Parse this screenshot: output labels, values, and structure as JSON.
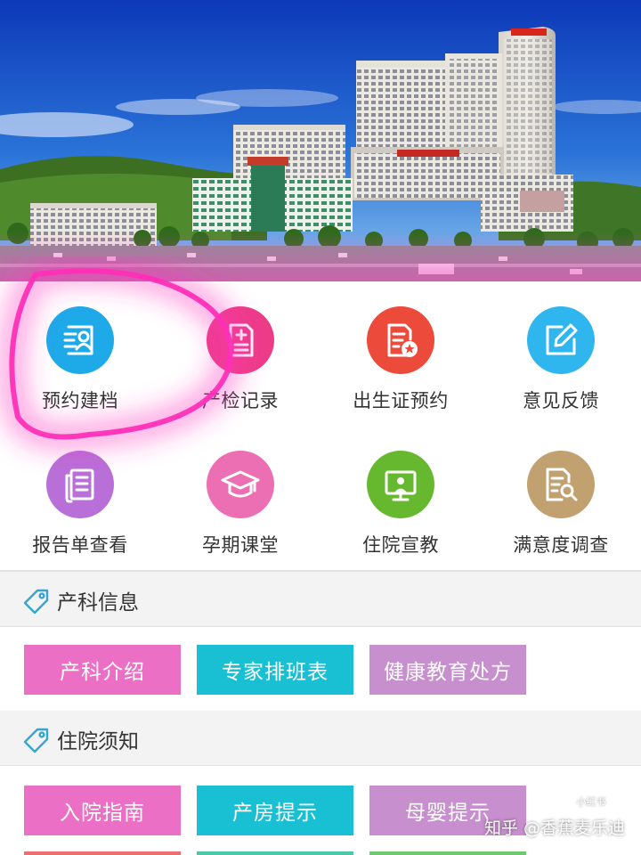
{
  "banner": {
    "image": "hospital-building-photo"
  },
  "grid": {
    "items": [
      {
        "label": "预约建档",
        "icon": "user-card-icon",
        "color": "#1ea9e8"
      },
      {
        "label": "产检记录",
        "icon": "medical-record-icon",
        "color": "#ec3c88"
      },
      {
        "label": "出生证预约",
        "icon": "certificate-star-icon",
        "color": "#ec4a3b"
      },
      {
        "label": "意见反馈",
        "icon": "edit-note-icon",
        "color": "#2fb6ee"
      },
      {
        "label": "报告单查看",
        "icon": "report-list-icon",
        "color": "#b86fd8"
      },
      {
        "label": "孕期课堂",
        "icon": "graduation-cap-icon",
        "color": "#ec6fb4"
      },
      {
        "label": "住院宣教",
        "icon": "presenter-board-icon",
        "color": "#66b92e"
      },
      {
        "label": "满意度调查",
        "icon": "document-search-icon",
        "color": "#c2a171"
      }
    ]
  },
  "sections": [
    {
      "title": "产科信息",
      "icon": "tag-icon",
      "buttons": [
        {
          "label": "产科介绍",
          "color": "#ec6fc6"
        },
        {
          "label": "专家排班表",
          "color": "#19bfd3"
        },
        {
          "label": "健康教育处方",
          "color": "#c78fce"
        }
      ]
    },
    {
      "title": "住院须知",
      "icon": "tag-icon",
      "buttons": [
        {
          "label": "入院指南",
          "color": "#ec6fc6"
        },
        {
          "label": "产房提示",
          "color": "#19bfd3"
        },
        {
          "label": "母婴提示",
          "color": "#c78fce"
        }
      ]
    }
  ],
  "watermark": {
    "text": "知乎 @香蕉麦乐迪",
    "badge": "小红书"
  },
  "colors": {
    "accent": "#34a6cf",
    "highlight": "#ff2fb8",
    "section_bg": "#f3f3f3"
  }
}
